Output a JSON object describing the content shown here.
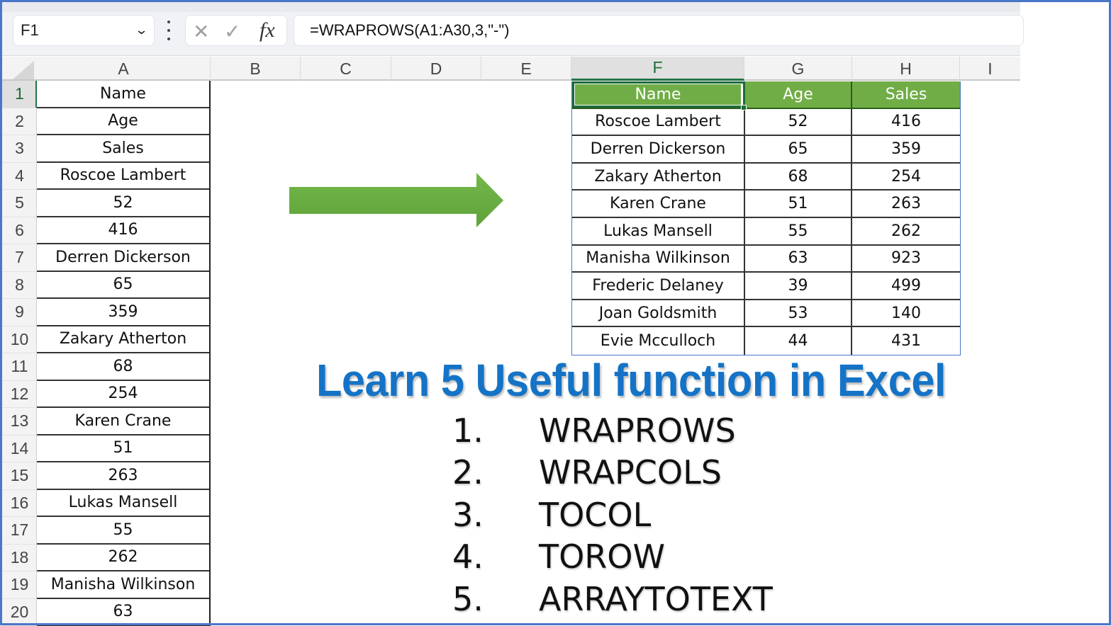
{
  "formula_bar": {
    "name_box": "F1",
    "cancel_icon": "close-icon",
    "enter_icon": "check-icon",
    "function_icon": "fx",
    "formula": "=WRAPROWS(A1:A30,3,\"-\")"
  },
  "columns": [
    "A",
    "B",
    "C",
    "D",
    "E",
    "F",
    "G",
    "H",
    "I"
  ],
  "selected_column": "F",
  "rows": [
    "1",
    "2",
    "3",
    "4",
    "5",
    "6",
    "7",
    "8",
    "9",
    "10",
    "11",
    "12",
    "13",
    "14",
    "15",
    "16",
    "17",
    "18",
    "19",
    "20"
  ],
  "column_a": [
    "Name",
    "Age",
    "Sales",
    "Roscoe Lambert",
    "52",
    "416",
    "Derren Dickerson",
    "65",
    "359",
    "Zakary Atherton",
    "68",
    "254",
    "Karen Crane",
    "51",
    "263",
    "Lukas Mansell",
    "55",
    "262",
    "Manisha Wilkinson",
    "63"
  ],
  "result_table": {
    "headers": [
      "Name",
      "Age",
      "Sales"
    ],
    "rows": [
      [
        "Roscoe Lambert",
        "52",
        "416"
      ],
      [
        "Derren Dickerson",
        "65",
        "359"
      ],
      [
        "Zakary Atherton",
        "68",
        "254"
      ],
      [
        "Karen Crane",
        "51",
        "263"
      ],
      [
        "Lukas Mansell",
        "55",
        "262"
      ],
      [
        "Manisha Wilkinson",
        "63",
        "923"
      ],
      [
        "Frederic Delaney",
        "39",
        "499"
      ],
      [
        "Joan Goldsmith",
        "53",
        "140"
      ],
      [
        "Evie Mcculloch",
        "44",
        "431"
      ]
    ]
  },
  "colors": {
    "header_green": "#70ad47",
    "arrow_green": "#6cb043",
    "headline_blue": "#1473c6",
    "selection_green": "#217346"
  },
  "headline": "Learn 5 Useful function in Excel",
  "functions": [
    {
      "num": "1.",
      "name": "WRAPROWS"
    },
    {
      "num": "2.",
      "name": "WRAPCOLS"
    },
    {
      "num": "3.",
      "name": "TOCOL"
    },
    {
      "num": "4.",
      "name": "TOROW"
    },
    {
      "num": "5.",
      "name": "ARRAYTOTEXT"
    }
  ]
}
